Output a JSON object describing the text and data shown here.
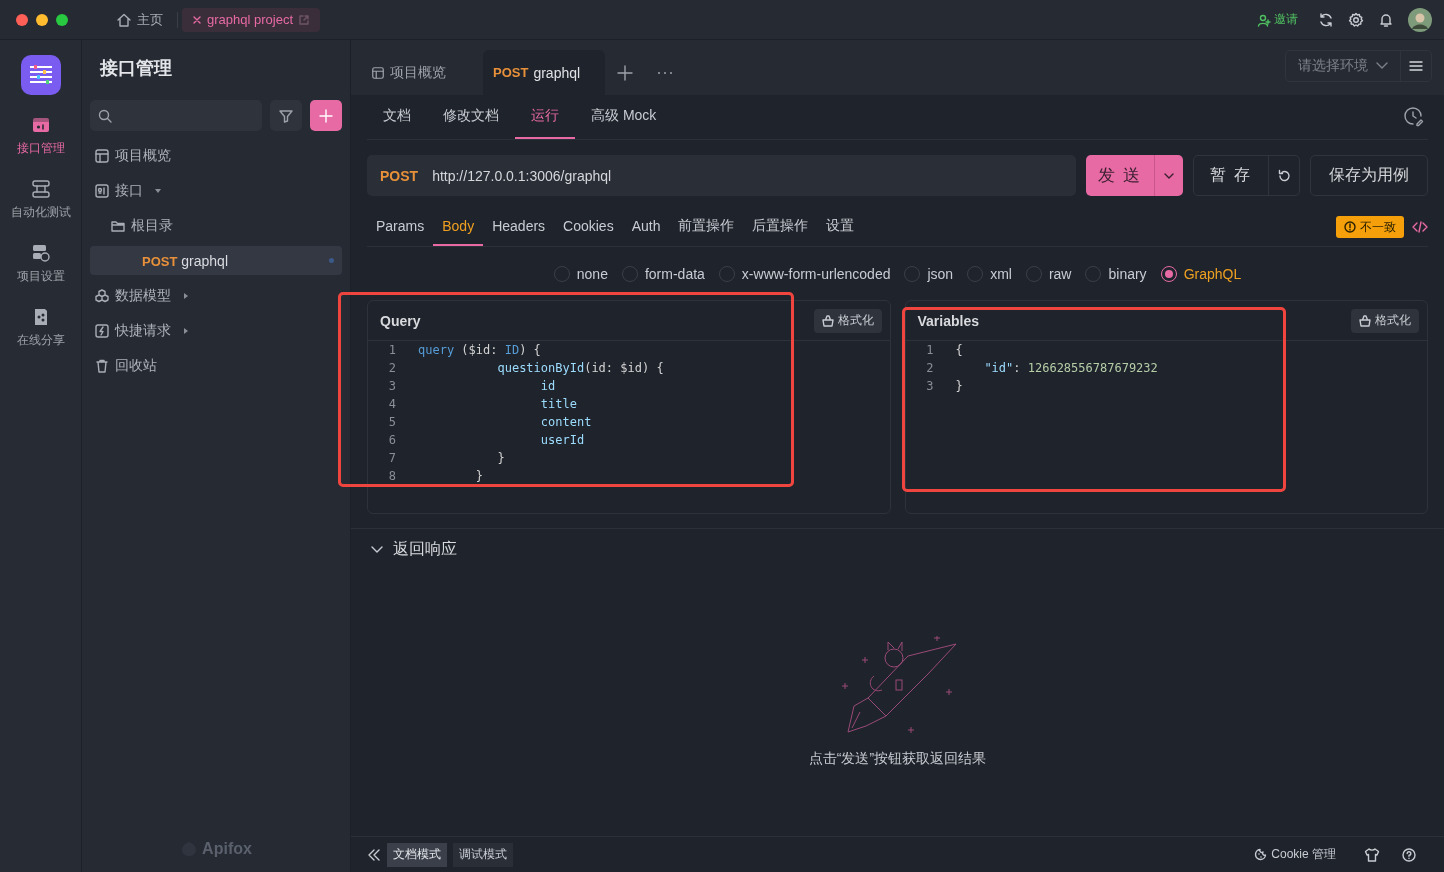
{
  "titlebar": {
    "tabs": [
      {
        "kind": "home",
        "label": "主页",
        "selected": false
      },
      {
        "kind": "project",
        "label": "graphql project",
        "selected": true
      }
    ],
    "invite": "邀请"
  },
  "rail": {
    "items": [
      {
        "kind": "api",
        "label": "接口管理",
        "selected": true
      },
      {
        "kind": "automation",
        "label": "自动化测试",
        "selected": false
      },
      {
        "kind": "settings",
        "label": "项目设置",
        "selected": false
      },
      {
        "kind": "share",
        "label": "在线分享",
        "selected": false
      }
    ]
  },
  "sidebar": {
    "title": "接口管理",
    "tree": [
      {
        "kind": "overview",
        "label": "项目概览",
        "selected": false
      },
      {
        "kind": "api",
        "label": "接口",
        "selected": false,
        "expanded": true,
        "children": [
          {
            "kind": "folder",
            "label": "根目录",
            "selected": false,
            "children": [
              {
                "kind": "endpoint",
                "method": "POST",
                "label": "graphql",
                "selected": true
              }
            ]
          }
        ]
      },
      {
        "kind": "models",
        "label": "数据模型",
        "selected": false,
        "expanded": false
      },
      {
        "kind": "quick",
        "label": "快捷请求",
        "selected": false,
        "expanded": false
      },
      {
        "kind": "trash",
        "label": "回收站",
        "selected": false
      }
    ],
    "brand": "Apifox"
  },
  "main_tabs": [
    {
      "kind": "overview",
      "label": "项目概览",
      "selected": false
    },
    {
      "kind": "request",
      "method": "POST",
      "label": "graphql",
      "selected": true
    }
  ],
  "environment": {
    "placeholder": "请选择环境"
  },
  "view_tabs": [
    {
      "label": "文档",
      "selected": false
    },
    {
      "label": "修改文档",
      "selected": false
    },
    {
      "label": "运行",
      "selected": true
    },
    {
      "label": "高级 Mock",
      "selected": false
    }
  ],
  "request": {
    "method": "POST",
    "url": "http://127.0.0.1:3006/graphql",
    "send": "发 送",
    "save_temp": "暂 存",
    "save_case": "保存为用例"
  },
  "param_tabs": [
    {
      "label": "Params",
      "selected": false
    },
    {
      "label": "Body",
      "selected": true
    },
    {
      "label": "Headers",
      "selected": false
    },
    {
      "label": "Cookies",
      "selected": false
    },
    {
      "label": "Auth",
      "selected": false
    },
    {
      "label": "前置操作",
      "selected": false
    },
    {
      "label": "后置操作",
      "selected": false
    },
    {
      "label": "设置",
      "selected": false
    }
  ],
  "status_badge": "不一致",
  "body_types": [
    {
      "label": "none",
      "selected": false
    },
    {
      "label": "form-data",
      "selected": false
    },
    {
      "label": "x-www-form-urlencoded",
      "selected": false
    },
    {
      "label": "json",
      "selected": false
    },
    {
      "label": "xml",
      "selected": false
    },
    {
      "label": "raw",
      "selected": false
    },
    {
      "label": "binary",
      "selected": false
    },
    {
      "label": "GraphQL",
      "selected": true
    }
  ],
  "editors": [
    {
      "title": "Query",
      "format_button": "格式化",
      "highlighted": true,
      "lines": [
        {
          "number": "1",
          "tokens": [
            {
              "kind": "keyword",
              "text": "query"
            },
            {
              "kind": "punct",
              "text": " ($id: "
            },
            {
              "kind": "keyword",
              "text": "ID"
            },
            {
              "kind": "punct",
              "text": ") {"
            }
          ]
        },
        {
          "number": "2",
          "tokens": [
            {
              "kind": "field",
              "text": "           questionById"
            },
            {
              "kind": "punct",
              "text": "(id: $id) {"
            }
          ]
        },
        {
          "number": "3",
          "tokens": [
            {
              "kind": "field",
              "text": "                 id"
            }
          ]
        },
        {
          "number": "4",
          "tokens": [
            {
              "kind": "field",
              "text": "                 title"
            }
          ]
        },
        {
          "number": "5",
          "tokens": [
            {
              "kind": "field",
              "text": "                 content"
            }
          ]
        },
        {
          "number": "6",
          "tokens": [
            {
              "kind": "field",
              "text": "                 userId"
            }
          ]
        },
        {
          "number": "7",
          "tokens": [
            {
              "kind": "punct",
              "text": "           }"
            }
          ]
        },
        {
          "number": "8",
          "tokens": [
            {
              "kind": "punct",
              "text": "        }"
            }
          ]
        }
      ]
    },
    {
      "title": "Variables",
      "format_button": "格式化",
      "highlighted": true,
      "lines": [
        {
          "number": "1",
          "tokens": [
            {
              "kind": "punct",
              "text": "{"
            }
          ]
        },
        {
          "number": "2",
          "tokens": [
            {
              "kind": "field",
              "text": "    \"id\""
            },
            {
              "kind": "punct",
              "text": ": "
            },
            {
              "kind": "number",
              "text": "126628556787679232"
            }
          ]
        },
        {
          "number": "3",
          "tokens": [
            {
              "kind": "punct",
              "text": "}"
            }
          ]
        }
      ]
    }
  ],
  "response": {
    "title": "返回响应",
    "expanded": true,
    "empty_hint": "点击“发送”按钮获取返回结果"
  },
  "footer": {
    "modes": [
      {
        "label": "文档模式",
        "selected": true
      },
      {
        "label": "调试模式",
        "selected": false
      }
    ],
    "cookie": "Cookie 管理"
  }
}
